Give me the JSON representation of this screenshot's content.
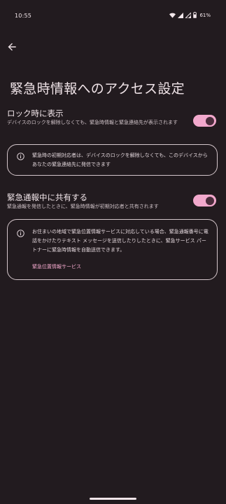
{
  "status_bar": {
    "time": "10:55",
    "battery": "61%"
  },
  "page": {
    "title": "緊急時情報へのアクセス設定"
  },
  "lock_screen": {
    "title": "ロック時に表示",
    "subtitle": "デバイスのロックを解除しなくても、緊急時情報と緊急連絡先が表示されます",
    "enabled": true,
    "info": "緊急時の初期対応者は、デバイスのロックを解除しなくても、このデバイスからあなたの緊急連絡先に発信できます"
  },
  "emergency_call": {
    "title": "緊急通報中に共有する",
    "subtitle": "緊急通報を発信したときに、緊急時情報が初期対応者と共有されます",
    "enabled": true,
    "info": "お住まいの地域で緊急位置情報サービスに対応している場合、緊急通報番号に電話をかけたりテキスト メッセージを送信したりしたときに、緊急サービス パートナーに緊急時情報を自動送信できます。",
    "link": "緊急位置情報サービス"
  },
  "colors": {
    "background": "#221b1f",
    "accent": "#f2a8cc",
    "toggle_knob": "#4a2c3b",
    "card_border": "#d4c6cb"
  },
  "icons": [
    "back-arrow-icon",
    "info-icon",
    "wifi-icon",
    "signal-icon",
    "battery-icon"
  ]
}
